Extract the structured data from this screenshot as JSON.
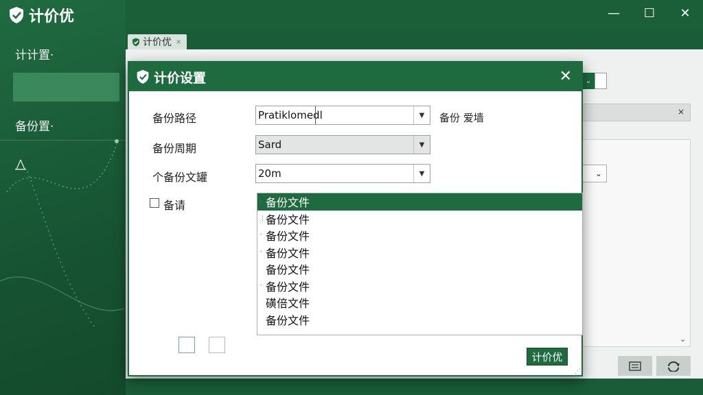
{
  "app": {
    "title": "计价优",
    "window_controls": {
      "minimize": "—",
      "maximize": "☐",
      "close": "✕"
    }
  },
  "sidebar": {
    "items": [
      {
        "label": "计计置·"
      },
      {
        "label": "备份置·"
      }
    ]
  },
  "background_tab": {
    "label": "计价优",
    "close": "×"
  },
  "background": {
    "field_clear": "×",
    "select_arrow": "⌄",
    "scroll_arrow": "⌄"
  },
  "dialog": {
    "title": "计价设置",
    "close": "✕",
    "backup_path": {
      "label": "备份路径",
      "value": "Pratiklomedl",
      "side_text": "备份 爱墙"
    },
    "backup_period": {
      "label": "备份周期",
      "value": "Sard"
    },
    "backup_files": {
      "label": "个备份文罐",
      "value": "20m"
    },
    "checkbox": {
      "label": "备请",
      "checked": false
    },
    "list": {
      "items": [
        "备份文件",
        "备份文件",
        "备份文件",
        "备份文件",
        "备份文件",
        "备份文件",
        "磺倍文件",
        "备份文件"
      ],
      "selected_index": 0
    },
    "ok_button": "计价优"
  },
  "colors": {
    "brand_green": "#1e6b40",
    "background_green": "#1a5c38",
    "selection_green": "#1e6b40"
  }
}
